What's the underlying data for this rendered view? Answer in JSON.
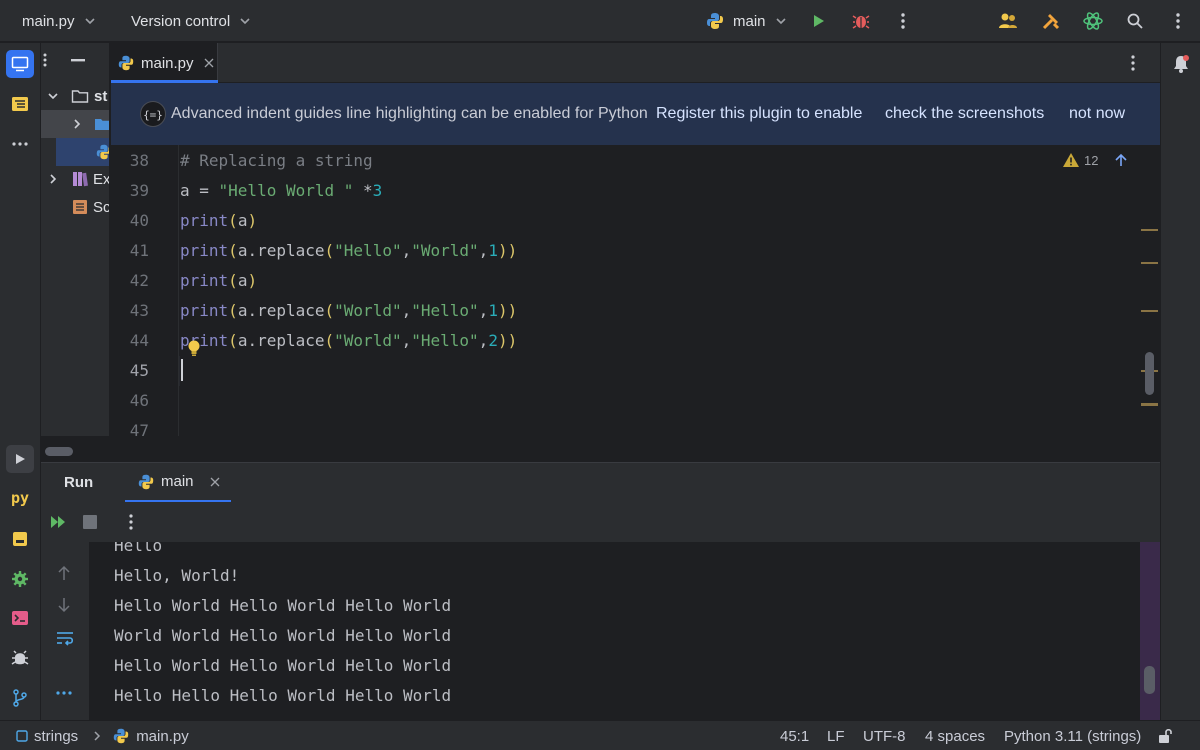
{
  "titlebar": {
    "project": "main.py",
    "vcs": "Version control",
    "run_config": "main"
  },
  "project_tree": {
    "items": [
      {
        "label": "st"
      },
      {
        "label": ""
      },
      {
        "label": ""
      },
      {
        "label": "Ex"
      },
      {
        "label": "Sc"
      }
    ]
  },
  "editor": {
    "tab": "main.py",
    "banner": {
      "message": "Advanced indent guides line highlighting can be enabled for Python",
      "register": "Register this plugin to enable",
      "screenshots": "check the screenshots",
      "dismiss": "not now"
    },
    "warnings_count": "12",
    "line_numbers": [
      "38",
      "39",
      "40",
      "41",
      "42",
      "43",
      "44",
      "45",
      "46",
      "47"
    ],
    "code_lines": [
      "# Replacing a string",
      "a = \"Hello World \" *3",
      "print(a)",
      "print(a.replace(\"Hello\",\"World\",1))",
      "print(a)",
      "print(a.replace(\"World\",\"Hello\",1))",
      "print(a.replace(\"World\",\"Hello\",2))",
      "",
      "",
      ""
    ]
  },
  "run": {
    "title": "Run",
    "tab": "main",
    "output": [
      "Hello",
      "Hello, World!",
      "Hello World Hello World Hello World",
      "World World Hello World Hello World",
      "Hello World Hello World Hello World",
      "Hello Hello Hello World Hello World"
    ]
  },
  "statusbar": {
    "breadcrumb_root": "strings",
    "breadcrumb_file": "main.py",
    "position": "45:1",
    "line_sep": "LF",
    "encoding": "UTF-8",
    "indent": "4 spaces",
    "interpreter": "Python 3.11 (strings)"
  },
  "colors": {
    "accent": "#3574f0",
    "background": "#1e1f22",
    "panel": "#2b2d30",
    "string": "#6aab73",
    "keyword": "#8888c6",
    "number": "#2aacb8"
  }
}
